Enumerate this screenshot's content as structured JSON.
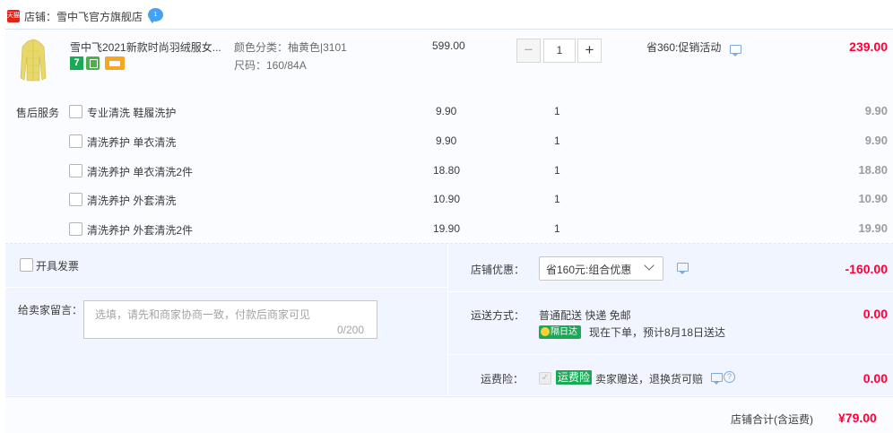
{
  "shop": {
    "badge_text": "天猫",
    "label": "店铺：雪中飞官方旗舰店",
    "chat_text": "1"
  },
  "product": {
    "title": "雪中飞2021新款时尚羽绒服女...",
    "badge_7": "7",
    "sku_color": "颜色分类：柚黄色|3101",
    "sku_size": "尺码：160/84A",
    "unit_price": "599.00",
    "quantity": "1",
    "promo": "省360:促销活动",
    "total": "239.00",
    "image_color": "#e8d86a"
  },
  "services": {
    "title": "售后服务",
    "items": [
      {
        "name": "专业清洗 鞋履洗护",
        "price": "9.90",
        "qty": "1",
        "total": "9.90"
      },
      {
        "name": "清洗养护 单衣清洗",
        "price": "9.90",
        "qty": "1",
        "total": "9.90"
      },
      {
        "name": "清洗养护 单衣清洗2件",
        "price": "18.80",
        "qty": "1",
        "total": "18.80"
      },
      {
        "name": "清洗养护 外套清洗",
        "price": "10.90",
        "qty": "1",
        "total": "10.90"
      },
      {
        "name": "清洗养护 外套清洗2件",
        "price": "19.90",
        "qty": "1",
        "total": "19.90"
      }
    ]
  },
  "invoice": {
    "label": "开具发票"
  },
  "memo": {
    "label": "给卖家留言：",
    "placeholder": "选填，请先和商家协商一致，付款后商家可见",
    "count": "0/200"
  },
  "discount": {
    "label": "店铺优惠：",
    "selected": "省160元:组合优惠",
    "amount": "-160.00"
  },
  "shipping": {
    "label": "运送方式：",
    "method": "普通配送 快递 免邮",
    "badge": "隔日达",
    "eta": "现在下单，预计8月18日送达",
    "amount": "0.00"
  },
  "insurance": {
    "label": "运费险：",
    "badge": "运费险",
    "text": "卖家赠送，退换货可赔",
    "amount": "0.00",
    "check_mark": "✓",
    "help_mark": "?"
  },
  "footer": {
    "label": "店铺合计(含运费)",
    "total": "¥79.00"
  },
  "colors": {
    "accent_red": "#ff0036",
    "green": "#1aaa55",
    "panel_bg": "#f1f5ff"
  }
}
